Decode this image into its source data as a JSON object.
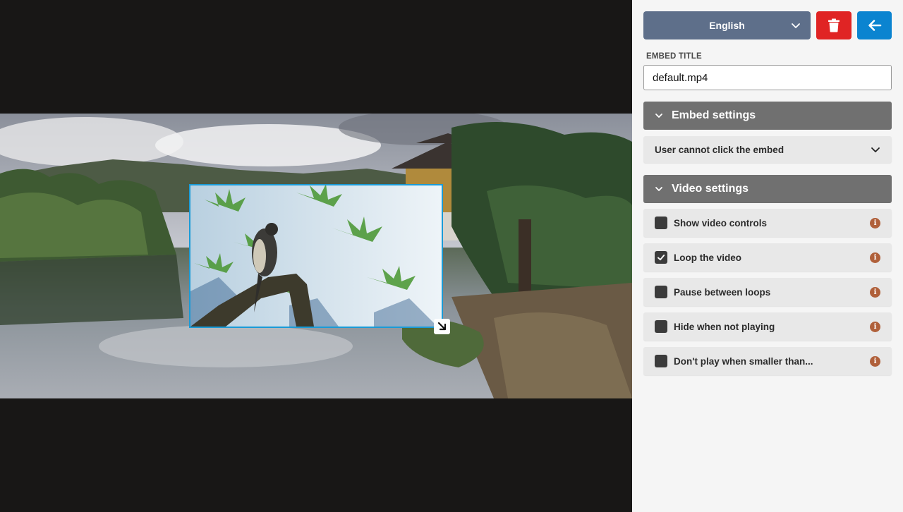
{
  "language": {
    "selected": "English"
  },
  "toolbar": {
    "delete_icon": "trash-icon",
    "back_icon": "arrow-left-icon"
  },
  "embed_title": {
    "label": "EMBED TITLE",
    "value": "default.mp4"
  },
  "embed_settings": {
    "header": "Embed settings",
    "click_behavior": "User cannot click the embed"
  },
  "video_settings": {
    "header": "Video settings",
    "options": [
      {
        "label": "Show video controls",
        "checked": false
      },
      {
        "label": "Loop the video",
        "checked": true
      },
      {
        "label": "Pause between loops",
        "checked": false
      },
      {
        "label": "Hide when not playing",
        "checked": false
      },
      {
        "label": "Don't play when smaller than...",
        "checked": false
      }
    ],
    "info_glyph": "i"
  },
  "colors": {
    "language_button": "#5e6f8a",
    "delete_button": "#e02424",
    "back_button": "#0b84d0",
    "section_header": "#707070",
    "info_icon": "#b0603a",
    "embed_border": "#1a9bd7"
  }
}
